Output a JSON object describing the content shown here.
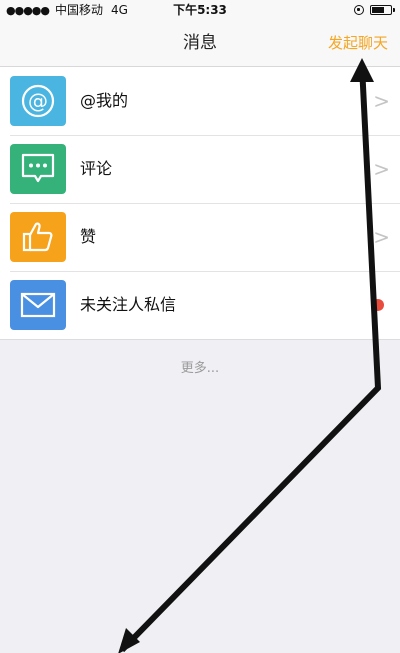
{
  "status_bar": {
    "signal": "●●●●●",
    "carrier": "中国移动",
    "network": "4G",
    "time": "下午5:33"
  },
  "nav": {
    "title": "消息",
    "action_label": "发起聊天",
    "action_color": "#f5a623"
  },
  "rows": [
    {
      "label": "@我的",
      "icon": "at-icon",
      "icon_color": "#4bb5e1",
      "chevron": ">"
    },
    {
      "label": "评论",
      "icon": "comment-icon",
      "icon_color": "#35b27a",
      "chevron": ">"
    },
    {
      "label": "赞",
      "icon": "thumbs-up-icon",
      "icon_color": "#f7a21b",
      "chevron": ">"
    },
    {
      "label": "未关注人私信",
      "icon": "mail-icon",
      "icon_color": "#4a90e2",
      "badge_color": "#e84c3d"
    }
  ],
  "more_label": "更多..."
}
